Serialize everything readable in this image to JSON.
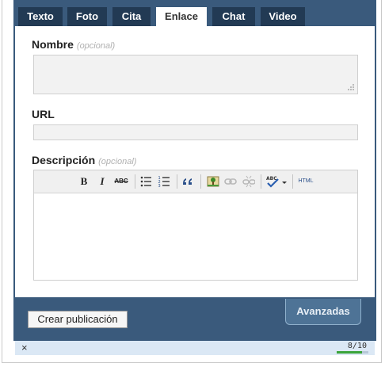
{
  "tabs": [
    {
      "label": "Texto"
    },
    {
      "label": "Foto"
    },
    {
      "label": "Cita"
    },
    {
      "label": "Enlace",
      "active": true
    },
    {
      "label": "Chat"
    },
    {
      "label": "Video"
    }
  ],
  "form": {
    "name_label": "Nombre",
    "name_optional": "(opcional)",
    "name_value": "",
    "url_label": "URL",
    "url_value": "",
    "description_label": "Descripción",
    "description_optional": "(opcional)",
    "description_value": ""
  },
  "toolbar": {
    "bold": "B",
    "italic": "I",
    "strike": "ABC",
    "html": "HTML",
    "icons": [
      "bold-icon",
      "italic-icon",
      "strikethrough-icon",
      "bullet-list-icon",
      "numbered-list-icon",
      "blockquote-icon",
      "image-icon",
      "link-icon",
      "unlink-icon",
      "spellcheck-icon",
      "html-icon"
    ]
  },
  "footer": {
    "create_button": "Crear publicación",
    "advanced_tab": "Avanzadas"
  },
  "status": {
    "close": "×",
    "counter": "8/10",
    "progress": 0.8
  },
  "colors": {
    "frame": "#3a5a7c",
    "tab_dark": "#223a54",
    "status_bg": "#dbe8f5",
    "progress": "#3aa43a"
  }
}
